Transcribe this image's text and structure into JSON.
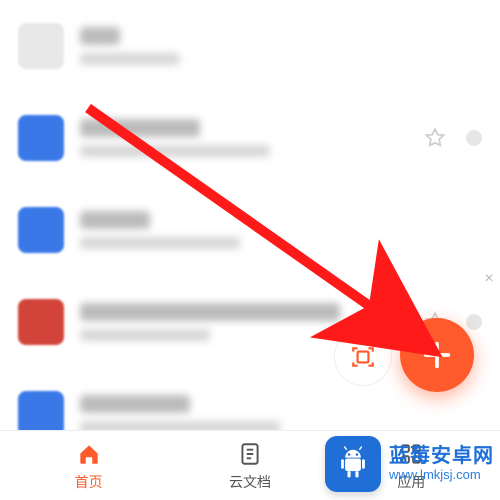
{
  "colors": {
    "accent": "#ff5a2b",
    "blue": "#3a78e8",
    "red": "#d2443a",
    "watermark_blue": "#1f6fd6"
  },
  "list_rows": [
    {
      "thumb": "light",
      "w1": 40,
      "w2": 100,
      "has_actions": false
    },
    {
      "thumb": "blue",
      "w1": 120,
      "w2": 190,
      "has_actions": true
    },
    {
      "thumb": "blue",
      "w1": 70,
      "w2": 160,
      "has_actions": false
    },
    {
      "thumb": "red",
      "w1": 260,
      "w2": 130,
      "has_actions": true
    },
    {
      "thumb": "blue",
      "w1": 110,
      "w2": 200,
      "has_actions": false
    }
  ],
  "fab": {
    "label": "+",
    "mini_label": "scan-icon"
  },
  "tabs": [
    {
      "key": "home",
      "label": "首页",
      "icon": "home-icon",
      "active": true
    },
    {
      "key": "cloud",
      "label": "云文档",
      "icon": "doc-icon",
      "active": false
    },
    {
      "key": "apps",
      "label": "应用",
      "icon": "grid-icon",
      "active": false
    }
  ],
  "watermark": {
    "title": "蓝莓安卓网",
    "url": "www.lmkjsj.com"
  },
  "close_label": "×"
}
